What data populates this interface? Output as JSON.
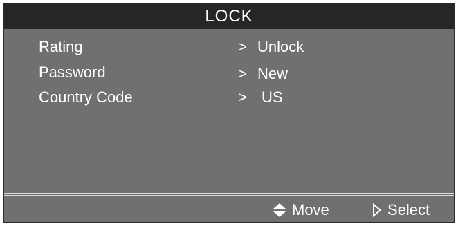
{
  "title": "LOCK",
  "menu": {
    "items": [
      {
        "label": "Rating",
        "arrow": ">",
        "value": "Unlock"
      },
      {
        "label": "Password",
        "arrow": ">",
        "value": "New"
      },
      {
        "label": "Country Code",
        "arrow": ">",
        "value": "US"
      }
    ]
  },
  "footer": {
    "move": {
      "icon": "up-down-arrows-icon",
      "label": "Move"
    },
    "select": {
      "icon": "play-right-icon",
      "label": "Select"
    }
  },
  "colors": {
    "panel": "#6e7072",
    "title_bar": "#262626",
    "text": "#ffffff"
  }
}
